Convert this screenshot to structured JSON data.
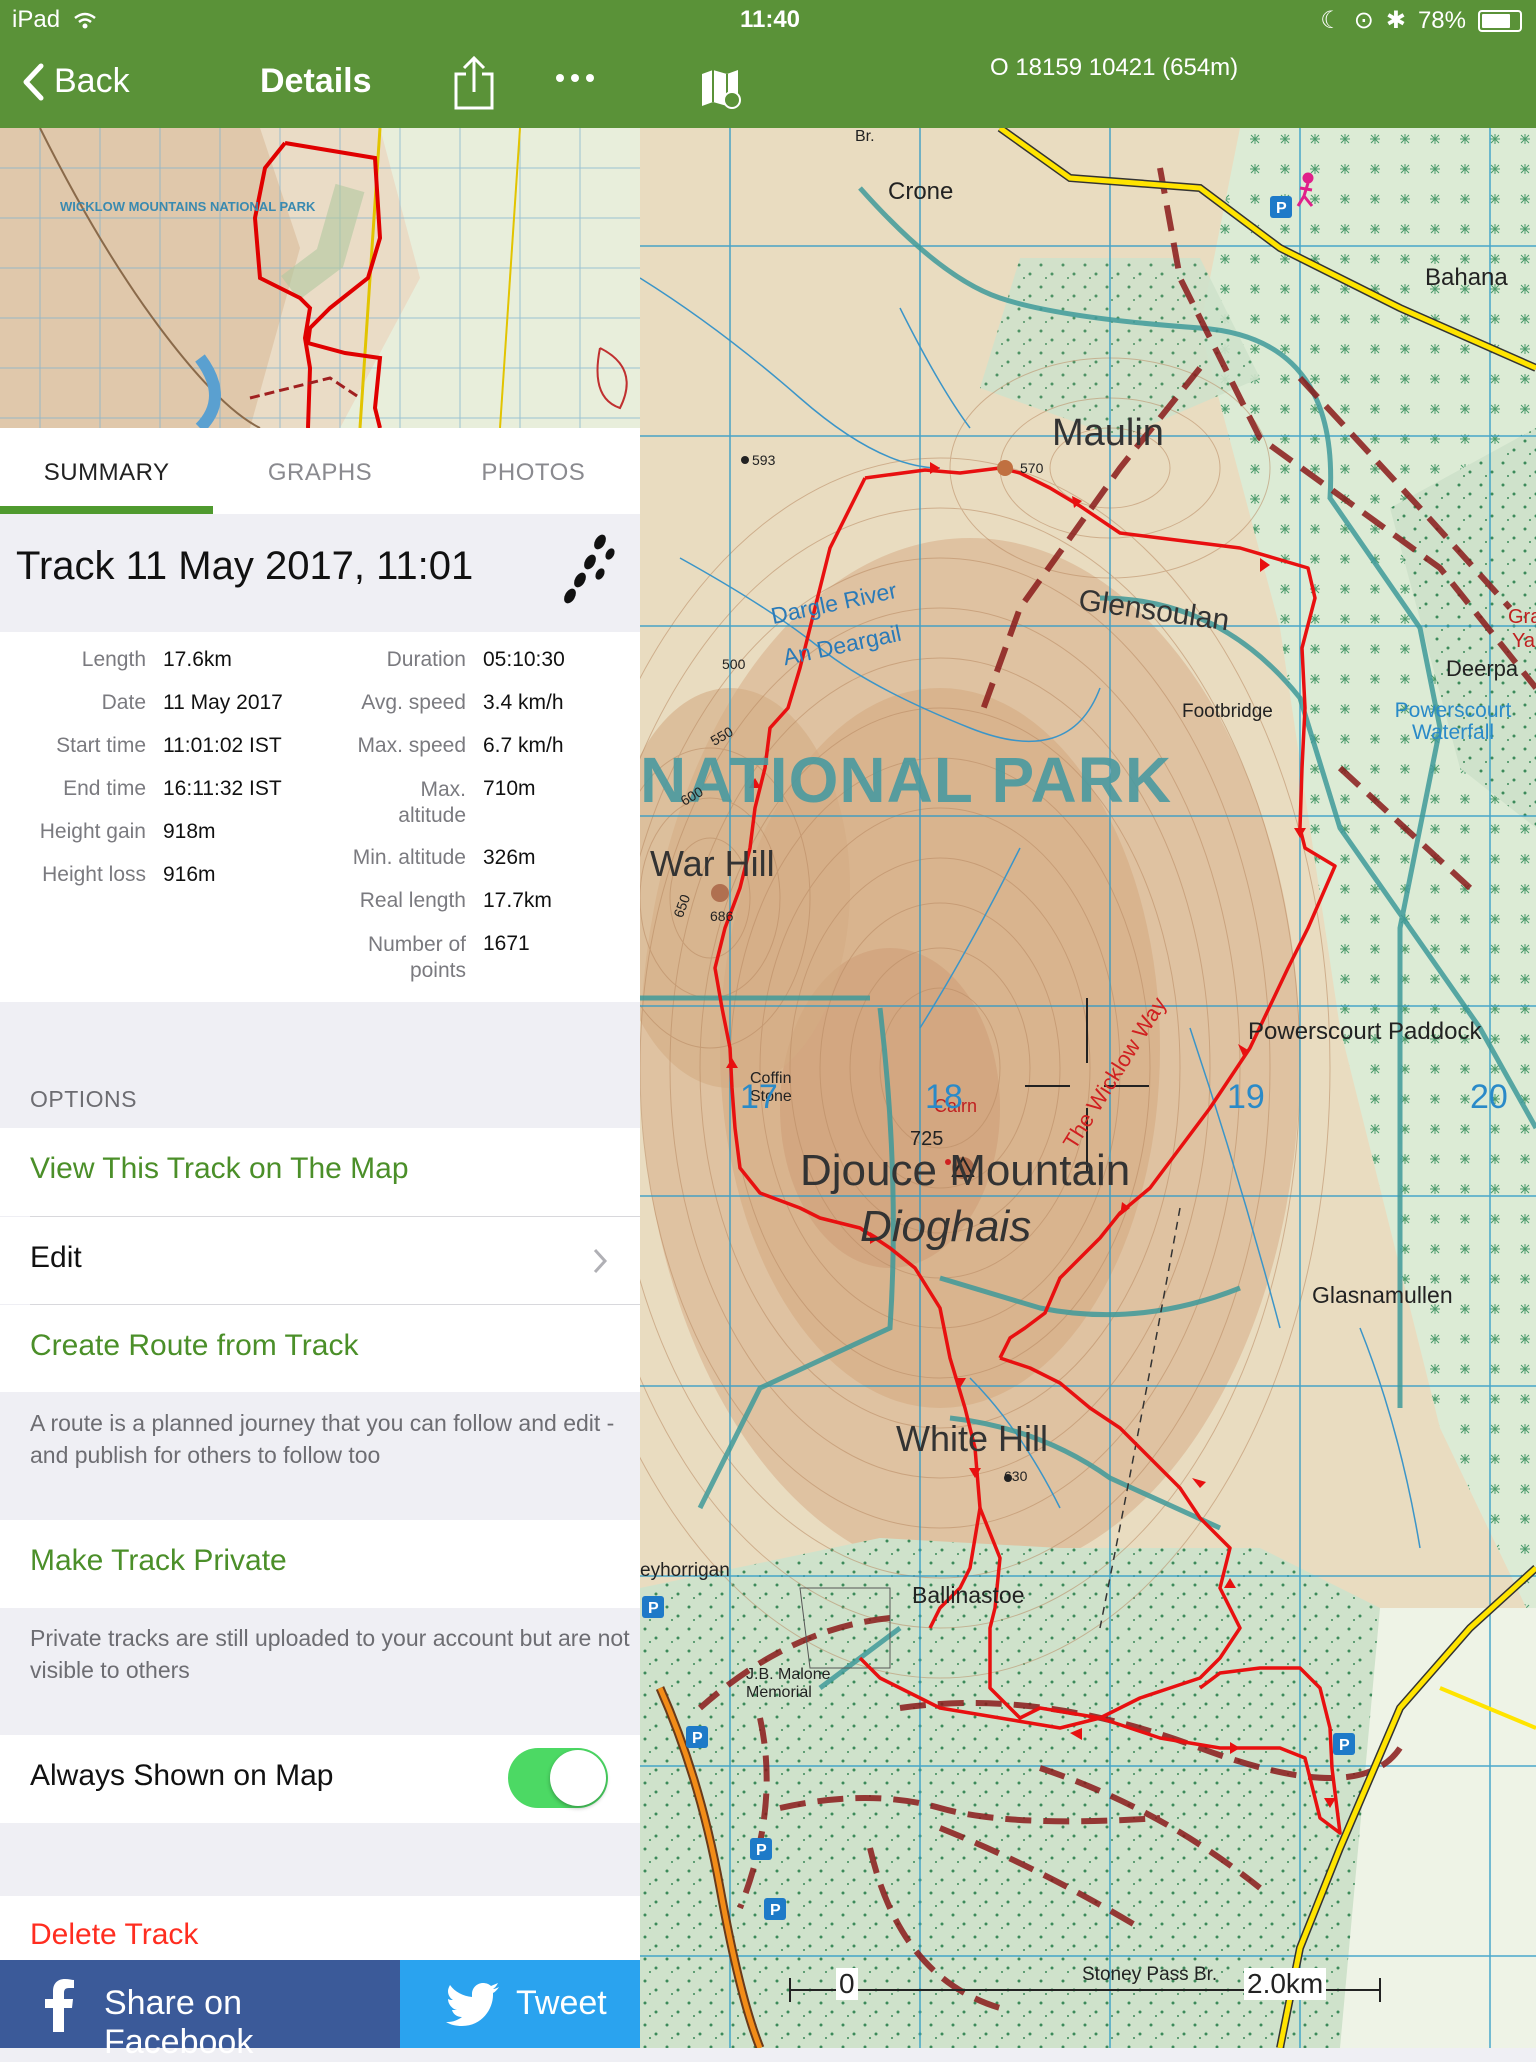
{
  "status_bar": {
    "device": "iPad",
    "time": "11:40",
    "battery": "78%"
  },
  "nav": {
    "back_label": "Back",
    "title": "Details",
    "coordinates": "O 18159 10421 (654m)"
  },
  "thumbnail": {
    "park_label": "WICKLOW MOUNTAINS NATIONAL PARK"
  },
  "tabs": [
    {
      "label": "SUMMARY",
      "active": true
    },
    {
      "label": "GRAPHS",
      "active": false
    },
    {
      "label": "PHOTOS",
      "active": false
    }
  ],
  "track": {
    "title": "Track 11 May 2017, 11:01"
  },
  "stats_left": [
    {
      "label": "Length",
      "value": "17.6km"
    },
    {
      "label": "Date",
      "value": "11 May 2017"
    },
    {
      "label": "Start time",
      "value": "11:01:02 IST"
    },
    {
      "label": "End time",
      "value": "16:11:32 IST"
    },
    {
      "label": "Height gain",
      "value": "918m"
    },
    {
      "label": "Height loss",
      "value": "916m"
    }
  ],
  "stats_right": [
    {
      "label": "Duration",
      "value": "05:10:30"
    },
    {
      "label": "Avg. speed",
      "value": "3.4 km/h"
    },
    {
      "label": "Max. speed",
      "value": "6.7 km/h"
    },
    {
      "label": "Max. altitude",
      "value": "710m"
    },
    {
      "label": "Min. altitude",
      "value": "326m"
    },
    {
      "label": "Real length",
      "value": "17.7km"
    },
    {
      "label": "Number of points",
      "value": "1671"
    }
  ],
  "options": {
    "header": "OPTIONS",
    "view_on_map": "View This Track on The Map",
    "edit": "Edit",
    "create_route": "Create Route from Track",
    "create_route_note": "A route is a planned journey that you can follow and edit - and publish for others to follow too",
    "make_private": "Make Track Private",
    "make_private_note": "Private tracks are still uploaded to your account but are not visible to others",
    "always_shown": "Always Shown on Map",
    "always_shown_enabled": true,
    "delete": "Delete Track"
  },
  "share": {
    "facebook": "Share on Facebook",
    "twitter": "Tweet"
  },
  "map": {
    "park": "NATIONAL PARK",
    "places": {
      "crone": "Crone",
      "bahana": "Bahana",
      "maulin": "Maulin",
      "glensoulan": "Glensoulan",
      "dargle": "Dargle River",
      "an_deargail": "An Deargail",
      "footbridge": "Footbridge",
      "powerscourt_waterfall": "Powerscourt Waterfall",
      "war_hill": "War Hill",
      "powerscourt_paddock": "Powerscourt Paddock",
      "wicklow_way": "The Wicklow Way",
      "coffin_stone": "Coffin Stone",
      "cairn": "Cairn",
      "djouce": "Djouce Mountain",
      "dioghais": "Dioghais",
      "glasnamullen": "Glasnamullen",
      "white_hill": "White Hill",
      "ballinastoe": "Ballinastoe",
      "jb_malone": "J.B. Malone Memorial",
      "stoney_pass": "Stoney Pass Br.",
      "deerpark": "Deerpa",
      "brittas": "Br.",
      "gra": "Gra",
      "ya": "Ya",
      "eyhorrigan": "eyhorrigan"
    },
    "heights": {
      "h593": "593",
      "h570": "570",
      "h686": "686",
      "h725": "725",
      "h630": "630",
      "h500": "500",
      "h550": "550",
      "h600": "600",
      "h650": "650"
    },
    "grid": {
      "g17": "17",
      "g18": "18",
      "g19": "19",
      "g20": "20"
    },
    "scale": {
      "start": "0",
      "end": "2.0km"
    }
  }
}
